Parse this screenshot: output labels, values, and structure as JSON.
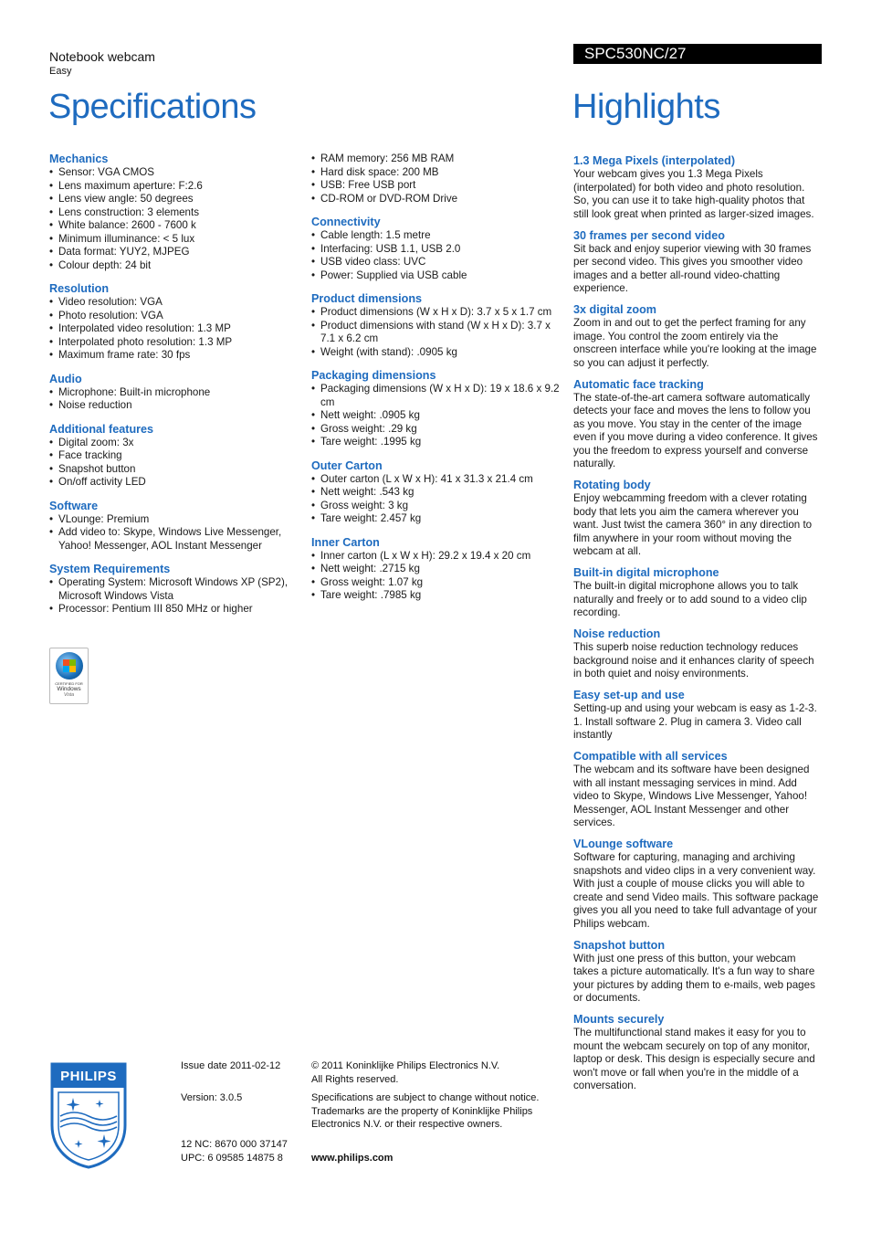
{
  "header": {
    "product_type": "Notebook webcam",
    "product_subtitle": "Easy",
    "model_number": "SPC530NC/27",
    "specifications_title": "Specifications",
    "highlights_title": "Highlights"
  },
  "colors": {
    "accent_blue": "#1e6bbf",
    "model_bar_bg": "#000000",
    "model_bar_text": "#ffffff"
  },
  "specifications": {
    "column1": [
      {
        "heading": "Mechanics",
        "items": [
          "Sensor: VGA CMOS",
          "Lens maximum aperture: F:2.6",
          "Lens view angle: 50 degrees",
          "Lens construction: 3 elements",
          "White balance: 2600 - 7600 k",
          "Minimum illuminance: < 5 lux",
          "Data format: YUY2, MJPEG",
          "Colour depth: 24 bit"
        ]
      },
      {
        "heading": "Resolution",
        "items": [
          "Video resolution: VGA",
          "Photo resolution: VGA",
          "Interpolated video resolution: 1.3 MP",
          "Interpolated photo resolution: 1.3 MP",
          "Maximum frame rate: 30 fps"
        ]
      },
      {
        "heading": "Audio",
        "items": [
          "Microphone: Built-in microphone",
          "Noise reduction"
        ]
      },
      {
        "heading": "Additional features",
        "items": [
          "Digital zoom: 3x",
          "Face tracking",
          "Snapshot button",
          "On/off activity LED"
        ]
      },
      {
        "heading": "Software",
        "items": [
          "VLounge: Premium",
          "Add video to: Skype, Windows Live Messenger, Yahoo! Messenger, AOL Instant Messenger"
        ]
      },
      {
        "heading": "System Requirements",
        "items": [
          "Operating System: Microsoft Windows XP (SP2), Microsoft Windows Vista",
          "Processor: Pentium III 850 MHz or higher"
        ]
      }
    ],
    "column2_continued": [
      "RAM memory: 256 MB RAM",
      "Hard disk space: 200 MB",
      "USB: Free USB port",
      "CD-ROM or DVD-ROM Drive"
    ],
    "column2": [
      {
        "heading": "Connectivity",
        "items": [
          "Cable length: 1.5 metre",
          "Interfacing: USB 1.1, USB 2.0",
          "USB video class: UVC",
          "Power: Supplied via USB cable"
        ]
      },
      {
        "heading": "Product dimensions",
        "items": [
          "Product dimensions (W x H x D): 3.7 x 5 x 1.7 cm",
          "Product dimensions with stand (W x H x D): 3.7 x 7.1 x 6.2 cm",
          "Weight (with stand): .0905 kg"
        ]
      },
      {
        "heading": "Packaging dimensions",
        "items": [
          "Packaging dimensions (W x H x D): 19 x 18.6 x 9.2 cm",
          "Nett weight: .0905 kg",
          "Gross weight: .29 kg",
          "Tare weight: .1995 kg"
        ]
      },
      {
        "heading": "Outer Carton",
        "items": [
          "Outer carton (L x W x H): 41 x 31.3 x 21.4 cm",
          "Nett weight: .543 kg",
          "Gross weight: 3 kg",
          "Tare weight: 2.457 kg"
        ]
      },
      {
        "heading": "Inner Carton",
        "items": [
          "Inner carton (L x W x H): 29.2 x 19.4 x 20 cm",
          "Nett weight: .2715 kg",
          "Gross weight: 1.07 kg",
          "Tare weight: .7985 kg"
        ]
      }
    ]
  },
  "vista_badge": {
    "line1": "CERTIFIED FOR",
    "line2": "Windows",
    "line3": "Vista"
  },
  "highlights": [
    {
      "heading": "1.3 Mega Pixels (interpolated)",
      "text": "Your webcam gives you 1.3 Mega Pixels (interpolated) for both video and photo resolution. So, you can use it to take high-quality photos that still look great when printed as larger-sized images."
    },
    {
      "heading": "30 frames per second video",
      "text": "Sit back and enjoy superior viewing with 30 frames per second video. This gives you smoother video images and a better all-round video-chatting experience."
    },
    {
      "heading": "3x digital zoom",
      "text": "Zoom in and out to get the perfect framing for any image. You control the zoom entirely via the onscreen interface while you're looking at the image so you can adjust it perfectly."
    },
    {
      "heading": "Automatic face tracking",
      "text": "The state-of-the-art camera software automatically detects your face and moves the lens to follow you as you move. You stay in the center of the image even if you move during a video conference. It gives you the freedom to express yourself and converse naturally."
    },
    {
      "heading": "Rotating body",
      "text": "Enjoy webcamming freedom with a clever rotating body that lets you aim the camera wherever you want. Just twist the camera 360° in any direction to film anywhere in your room without moving the webcam at all."
    },
    {
      "heading": "Built-in digital microphone",
      "text": "The built-in digital microphone allows you to talk naturally and freely or to add sound to a video clip recording."
    },
    {
      "heading": "Noise reduction",
      "text": "This superb noise reduction technology reduces background noise and it enhances clarity of speech in both quiet and noisy environments."
    },
    {
      "heading": "Easy set-up and use",
      "text": "Setting-up and using your webcam is easy as 1-2-3. 1. Install software 2. Plug in camera 3. Video call instantly"
    },
    {
      "heading": "Compatible with all services",
      "text": "The webcam and its software have been designed with all instant messaging services in mind. Add video to Skype, Windows Live Messenger, Yahoo! Messenger, AOL Instant Messenger and other services."
    },
    {
      "heading": "VLounge software",
      "text": "Software for capturing, managing and archiving snapshots and video clips in a very convenient way. With just a couple of mouse clicks you will able to create and send Video mails. This software package gives you all you need to take full advantage of your Philips webcam."
    },
    {
      "heading": "Snapshot button",
      "text": "With just one press of this button, your webcam takes a picture automatically. It's a fun way to share your pictures by adding them to e-mails, web pages or documents."
    },
    {
      "heading": "Mounts securely",
      "text": "The multifunctional stand makes it easy for you to mount the webcam securely on top of any monitor, laptop or desk. This design is especially secure and won't move or fall when you're in the middle of a conversation."
    }
  ],
  "footer": {
    "logo_text": "PHILIPS",
    "issue_date": "Issue date 2011-02-12",
    "version": "Version: 3.0.5",
    "nc": "12 NC: 8670 000 37147",
    "upc": "UPC: 6 09585 14875 8",
    "copyright_line1": "© 2011 Koninklijke Philips Electronics N.V.",
    "copyright_line2": "All Rights reserved.",
    "disclaimer": "Specifications are subject to change without notice. Trademarks are the property of Koninklijke Philips Electronics N.V. or their respective owners.",
    "url": "www.philips.com"
  }
}
